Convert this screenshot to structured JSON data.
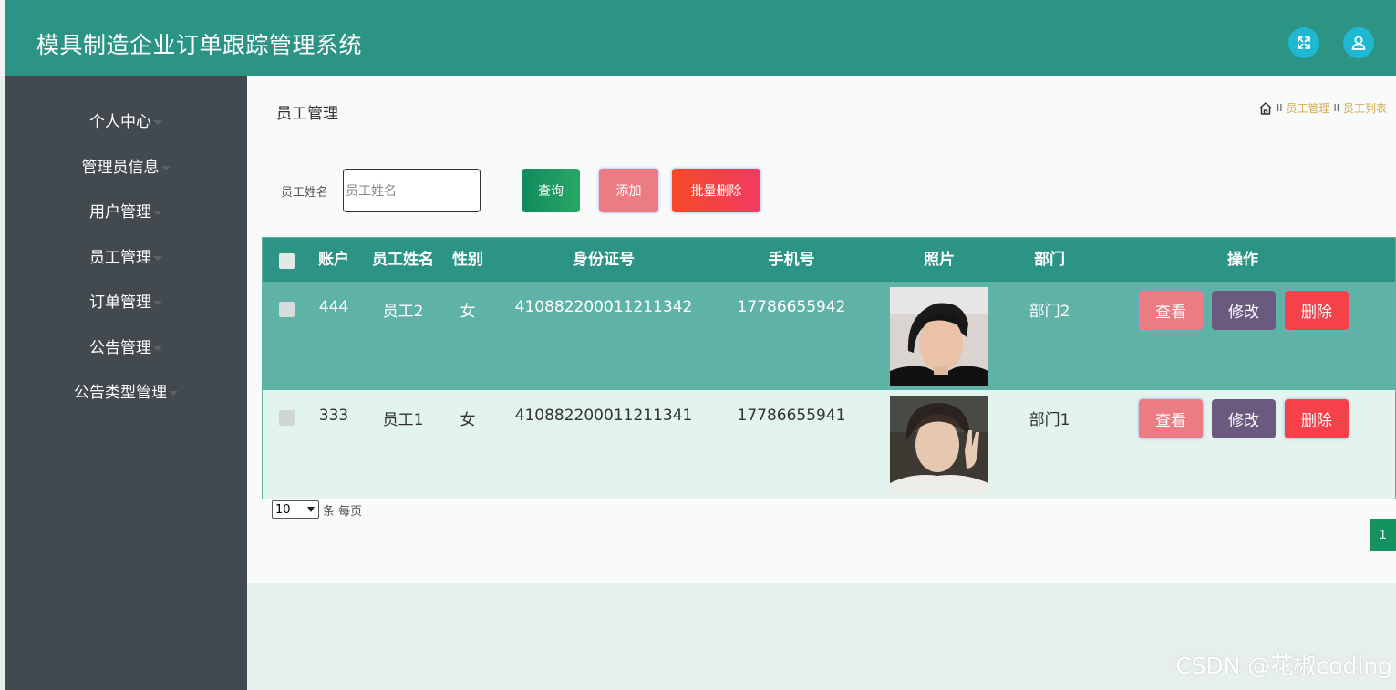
{
  "header": {
    "title": "模具制造企业订单跟踪管理系统",
    "expand_icon": "expand-icon",
    "user_icon": "user-icon"
  },
  "sidebar": {
    "items": [
      {
        "label": "个人中心"
      },
      {
        "label": "管理员信息"
      },
      {
        "label": "用户管理"
      },
      {
        "label": "员工管理"
      },
      {
        "label": "订单管理"
      },
      {
        "label": "公告管理"
      },
      {
        "label": "公告类型管理"
      }
    ]
  },
  "main": {
    "title": "员工管理",
    "breadcrumb": [
      "员工管理",
      "员工列表"
    ],
    "breadcrumb_sep": "II"
  },
  "search": {
    "label": "员工姓名",
    "placeholder": "员工姓名",
    "value": "",
    "query_label": "查询",
    "add_label": "添加",
    "batch_delete_label": "批量删除"
  },
  "table": {
    "columns": [
      "账户",
      "员工姓名",
      "性别",
      "身份证号",
      "手机号",
      "照片",
      "部门",
      "操作"
    ],
    "rows": [
      {
        "account": "444",
        "name": "员工2",
        "gender": "女",
        "id_number": "410882200011211342",
        "phone": "17786655942",
        "department": "部门2"
      },
      {
        "account": "333",
        "name": "员工1",
        "gender": "女",
        "id_number": "410882200011211341",
        "phone": "17786655941",
        "department": "部门1"
      }
    ],
    "actions": {
      "view": "查看",
      "edit": "修改",
      "delete": "删除"
    }
  },
  "pagination": {
    "page_size": "10",
    "per_page_text": "条 每页",
    "current_page": "1"
  },
  "watermark": "CSDN @花椒coding",
  "colors": {
    "header": "#2b9485",
    "sidebar": "#424a4f",
    "row_odd": "#5fb2a6",
    "row_even": "#e3f3ee",
    "view_button": "#ec7c84",
    "edit_button": "#6a5a80",
    "delete_button": "#f5424a"
  }
}
